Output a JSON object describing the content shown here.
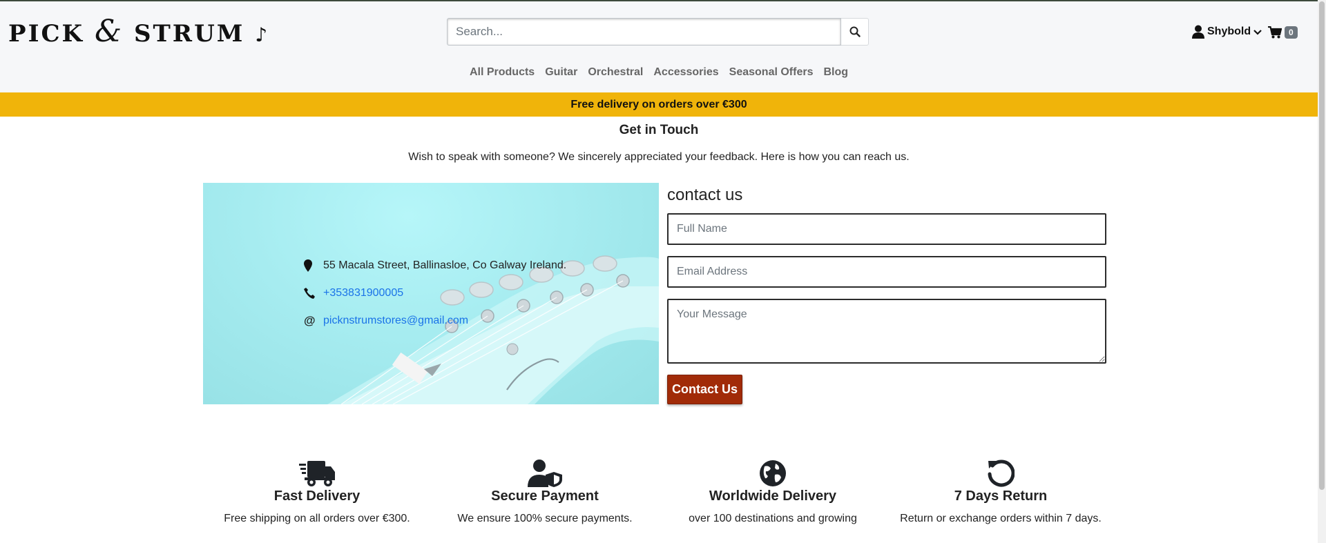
{
  "header": {
    "logo_text_1": "PICK",
    "logo_amp": "&",
    "logo_text_2": "STRUM",
    "search_placeholder": "Search...",
    "account_name": "Shybold",
    "cart_count": "0"
  },
  "nav": {
    "items": [
      "All Products",
      "Guitar",
      "Orchestral",
      "Accessories",
      "Seasonal Offers",
      "Blog"
    ]
  },
  "promo": {
    "text": "Free delivery on orders over €300"
  },
  "main": {
    "title": "Get in Touch",
    "subtitle": "Wish to speak with someone? We sincerely appreciated your feedback. Here is how you can reach us.",
    "address": "55 Macala Street, Ballinasloe, Co Galway Ireland.",
    "phone": "+353831900005",
    "email": "picknstrumstores@gmail.com",
    "email_symbol": "@"
  },
  "form": {
    "heading": "contact us",
    "name_placeholder": "Full Name",
    "email_placeholder": "Email Address",
    "message_placeholder": "Your Message",
    "submit_label": "Contact Us"
  },
  "features": [
    {
      "title": "Fast Delivery",
      "text": "Free shipping on all orders over €300.",
      "icon": "truck-icon"
    },
    {
      "title": "Secure Payment",
      "text": "We ensure 100% secure payments.",
      "icon": "user-shield-icon"
    },
    {
      "title": "Worldwide Delivery",
      "text": "over 100 destinations and growing",
      "icon": "globe-icon"
    },
    {
      "title": "7 Days Return",
      "text": "Return or exchange orders within 7 days.",
      "icon": "return-icon"
    }
  ],
  "colors": {
    "promo_bg": "#f0b40a",
    "button_bg": "#a12b08",
    "link": "#1a73e8",
    "panel_bg": "#a6ecf0"
  }
}
